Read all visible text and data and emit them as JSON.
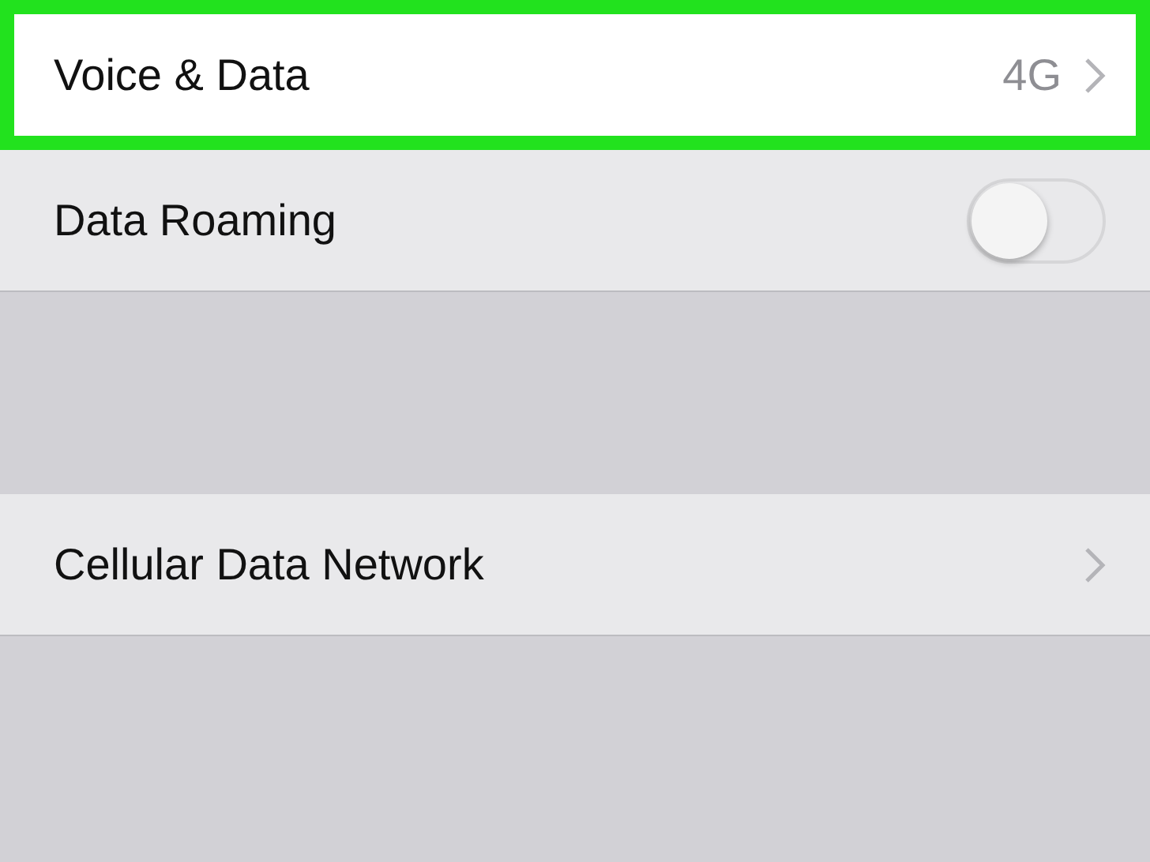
{
  "groups": [
    {
      "rows": [
        {
          "kind": "link",
          "label": "Voice & Data",
          "value": "4G",
          "highlighted": true
        },
        {
          "kind": "toggle",
          "label": "Data Roaming",
          "on": false,
          "highlighted": false
        }
      ]
    },
    {
      "rows": [
        {
          "kind": "link",
          "label": "Cellular Data Network",
          "highlighted": false
        }
      ]
    }
  ]
}
